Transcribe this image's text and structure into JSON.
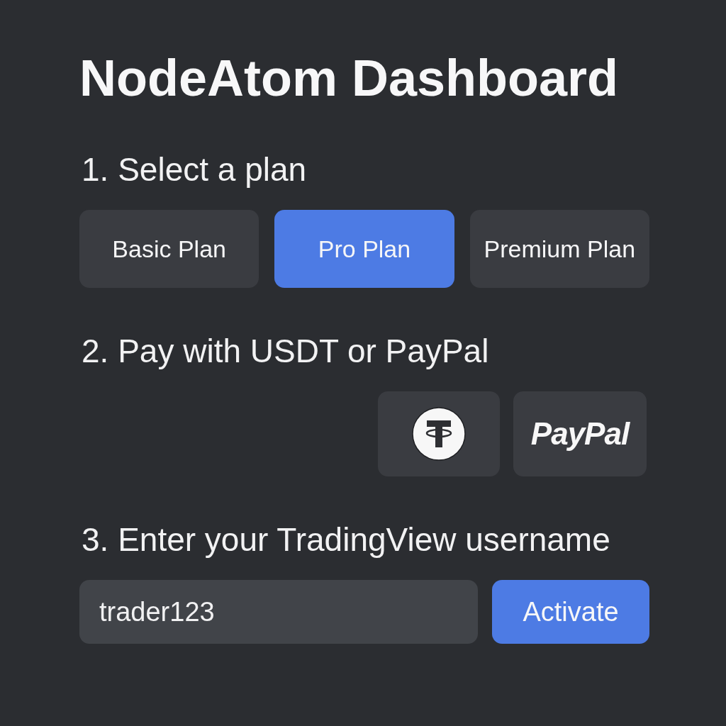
{
  "title": "NodeAtom Dashboard",
  "steps": [
    {
      "kind": "plans",
      "heading": "1. Select a plan",
      "plans": [
        {
          "label": "Basic Plan",
          "selected": false
        },
        {
          "label": "Pro Plan",
          "selected": true
        },
        {
          "label": "Premium Plan",
          "selected": false
        }
      ]
    },
    {
      "kind": "payment",
      "heading": "2. Pay with USDT or PayPal",
      "methods": [
        {
          "kind": "tether"
        },
        {
          "kind": "paypal",
          "label": "PayPal"
        }
      ]
    },
    {
      "kind": "username",
      "heading": "3. Enter your TradingView username",
      "input": {
        "value": "trader123"
      },
      "button": "Activate"
    }
  ]
}
